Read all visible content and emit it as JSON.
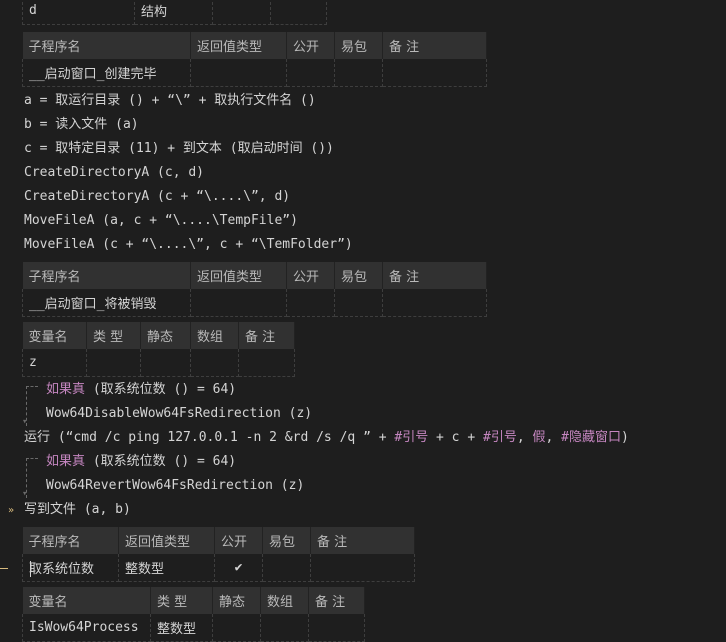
{
  "top_row": {
    "name": "d",
    "type": "结构"
  },
  "sub1": {
    "headers": [
      "子程序名",
      "返回值类型",
      "公开",
      "易包",
      "备 注"
    ],
    "name": "__启动窗口_创建完毕"
  },
  "code1": [
    "a = 取运行目录 () + “\\” + 取执行文件名 ()",
    "b = 读入文件 (a)",
    "c = 取特定目录 (11) + 到文本 (取启动时间 ())",
    "CreateDirectoryA (c, d)",
    "CreateDirectoryA (c + “\\....\\”, d)",
    "MoveFileA (a, c + “\\....\\TempFile”)",
    "MoveFileA (c + “\\....\\”, c + “\\TemFolder”)"
  ],
  "sub2": {
    "headers": [
      "子程序名",
      "返回值类型",
      "公开",
      "易包",
      "备 注"
    ],
    "name": "__启动窗口_将被销毁"
  },
  "vars2": {
    "headers": [
      "变量名",
      "类 型",
      "静态",
      "数组",
      "备 注"
    ],
    "name": "z"
  },
  "code2": {
    "if1_kw": "如果真",
    "if1_rest": " (取系统位数 () = 64)",
    "if1_body": "Wow64DisableWow64FsRedirection (z)",
    "run_a": "运行 (“cmd /c ping 127.0.0.1 -n 2 &rd /s /q ” + ",
    "run_b": "#引号",
    "run_c": " + c + ",
    "run_d": "#引号",
    "run_e": ", ",
    "run_f": "假",
    "run_g": ", ",
    "run_h": "#隐藏窗口",
    "run_i": ")",
    "if2_kw": "如果真",
    "if2_rest": " (取系统位数 () = 64)",
    "if2_body": "Wow64RevertWow64FsRedirection (z)",
    "write": "写到文件 (a, b)"
  },
  "sub3": {
    "headers": [
      "子程序名",
      "返回值类型",
      "公开",
      "易包",
      "备 注"
    ],
    "name": "取系统位数",
    "ret_type": "整数型",
    "public_check": "✔"
  },
  "vars3": {
    "headers": [
      "变量名",
      "类 型",
      "静态",
      "数组",
      "备 注"
    ],
    "name": "IsWow64Process",
    "type": "整数型"
  },
  "colors": {
    "background": "#1e1e1e",
    "keyword": "#c586c0",
    "type": "#4fc1ff",
    "header_bg": "#313131"
  }
}
